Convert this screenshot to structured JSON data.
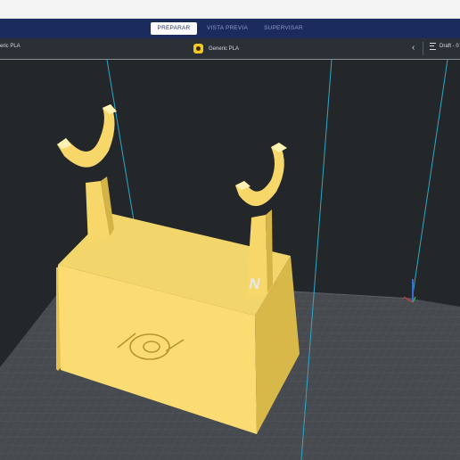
{
  "stages": {
    "prepare": "PREPARAR",
    "preview": "VISTA PREVIA",
    "monitor": "SUPERVISAR"
  },
  "toolbar": {
    "material_left": "eric PLA",
    "material_center": "Generic PLA",
    "profile": "Draft - 0"
  },
  "icons": {
    "material": "material-badge-icon",
    "back": "chevron-left-icon",
    "profile": "print-settings-icon"
  },
  "colors": {
    "stage_bar": "#1c2b5e",
    "viewport_bg": "#23272a",
    "build_plate": "#474b4f",
    "model": "#f7d76a",
    "volume_edge": "#2fa7c7"
  },
  "model": {
    "text_mark": "N"
  }
}
